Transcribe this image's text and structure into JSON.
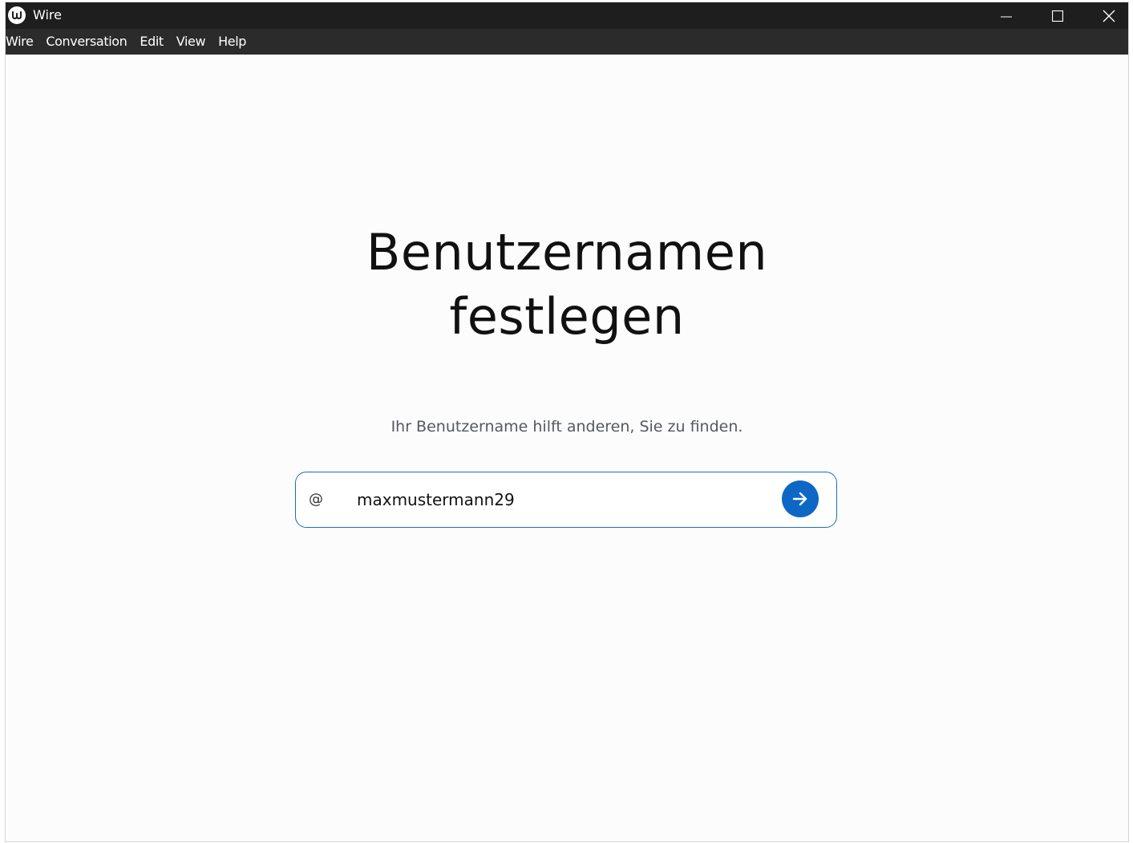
{
  "window": {
    "title": "Wire"
  },
  "menu": [
    "Wire",
    "Conversation",
    "Edit",
    "View",
    "Help"
  ],
  "main": {
    "heading_line1": "Benutzernamen",
    "heading_line2": "festlegen",
    "subtitle": "Ihr Benutzername hilft anderen, Sie zu finden.",
    "at_symbol": "@",
    "username_value": "maxmustermann29"
  },
  "icons": {
    "app": "wire-logo-icon",
    "minimize": "minimize-icon",
    "maximize": "maximize-icon",
    "close": "close-icon",
    "submit": "arrow-right-icon"
  },
  "colors": {
    "titlebar": "#1e1e1f",
    "menubar": "#2b2b2c",
    "accent": "#0e67c4",
    "field_border": "#1b6fb5"
  }
}
